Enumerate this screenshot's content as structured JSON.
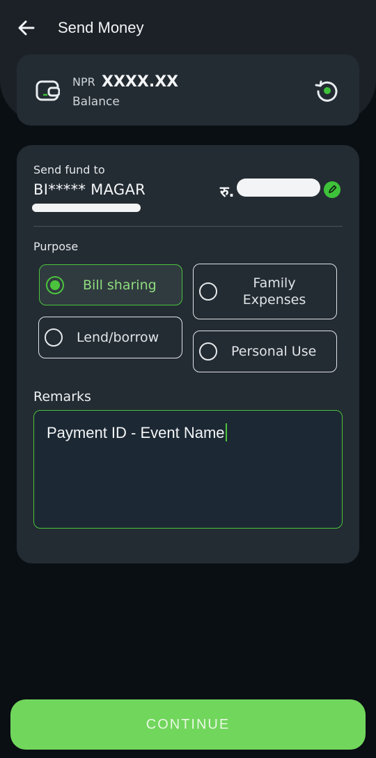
{
  "header": {
    "title": "Send Money"
  },
  "balance": {
    "currency": "NPR",
    "amount": "XXXX.XX",
    "label": "Balance"
  },
  "recipient": {
    "label": "Send fund to",
    "name": "BI***** MAGAR",
    "amount_prefix": "रु."
  },
  "purpose": {
    "label": "Purpose",
    "options": [
      {
        "label": "Bill sharing",
        "selected": true
      },
      {
        "label": "Family Expenses",
        "selected": false
      },
      {
        "label": "Lend/borrow",
        "selected": false
      },
      {
        "label": "Personal Use",
        "selected": false
      }
    ]
  },
  "remarks": {
    "label": "Remarks",
    "value": "Payment ID - Event Name"
  },
  "footer": {
    "continue_label": "CONTINUE"
  },
  "colors": {
    "accent": "#4cc33d",
    "button": "#71d65c",
    "card": "#242c33",
    "background": "#0a0f13"
  }
}
